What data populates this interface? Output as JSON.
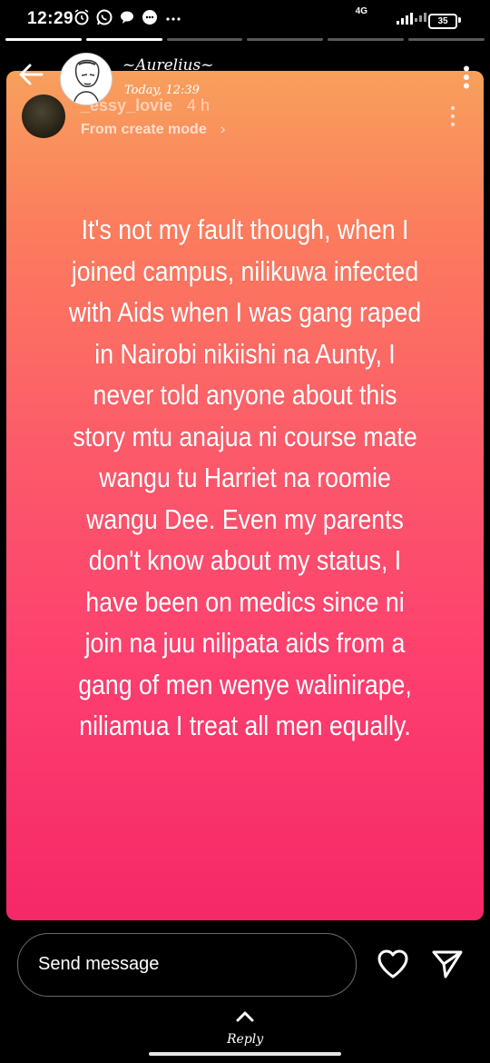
{
  "status_bar": {
    "time": "12:29",
    "network": "4G",
    "battery": "35",
    "icons": [
      "alarm-icon",
      "whatsapp-icon",
      "chat-bubble-icon",
      "message-icon",
      "more-dots-icon"
    ]
  },
  "whatsapp_header": {
    "contact_name": "~Aurelius~",
    "timestamp": "Today, 12:39"
  },
  "instagram_story": {
    "username": "_essy_lovie",
    "age": "4 h",
    "mode_label": "From create mode",
    "text": "It's not my fault though, when I joined campus, nilikuwa infected with Aids when I was gang raped in Nairobi nikiishi na Aunty, I never told anyone about this story mtu anajua ni course mate wangu tu Harriet na roomie wangu Dee. Even my parents don't know about my status, I have been on medics since ni join na juu nilipata aids from a gang of men wenye walinirape, niliamua I treat all men equally.",
    "gradient_colors": [
      "#f8a05c",
      "#fc5a6a",
      "#f52868"
    ]
  },
  "reply_bar": {
    "placeholder": "Send message",
    "reply_label": "Reply"
  },
  "progress": {
    "total_segments": 6,
    "completed_segments": 2
  }
}
